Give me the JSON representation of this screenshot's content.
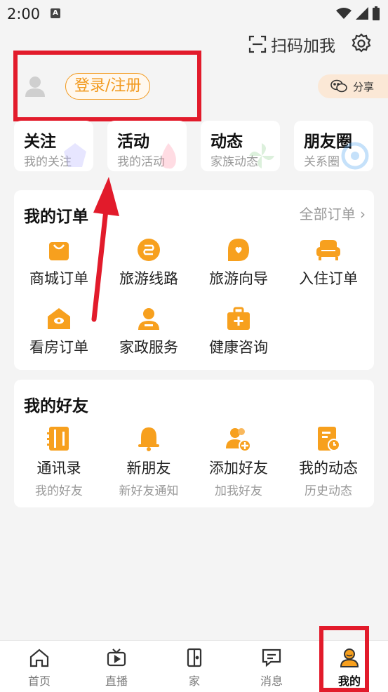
{
  "status_bar": {
    "time": "2:00",
    "notif_letter": "A"
  },
  "header": {
    "scan_label": "扫码加我",
    "login_label": "登录/注册",
    "share_label": "分享"
  },
  "quick_links": [
    {
      "title": "关注",
      "sub": "我的关注"
    },
    {
      "title": "活动",
      "sub": "我的活动"
    },
    {
      "title": "动态",
      "sub": "家族动态"
    },
    {
      "title": "朋友圈",
      "sub": "关系圈"
    }
  ],
  "orders": {
    "title": "我的订单",
    "all_label": "全部订单",
    "items": [
      {
        "label": "商城订单",
        "icon": "shopping-bag-icon"
      },
      {
        "label": "旅游线路",
        "icon": "route-icon"
      },
      {
        "label": "旅游向导",
        "icon": "guide-icon"
      },
      {
        "label": "入住订单",
        "icon": "sofa-icon"
      },
      {
        "label": "看房订单",
        "icon": "house-view-icon"
      },
      {
        "label": "家政服务",
        "icon": "housekeeper-icon"
      },
      {
        "label": "健康咨询",
        "icon": "medical-kit-icon"
      }
    ]
  },
  "friends": {
    "title": "我的好友",
    "items": [
      {
        "label": "通讯录",
        "sub": "我的好友",
        "icon": "contacts-icon"
      },
      {
        "label": "新朋友",
        "sub": "新好友通知",
        "icon": "bell-icon"
      },
      {
        "label": "添加好友",
        "sub": "加我好友",
        "icon": "add-friend-icon"
      },
      {
        "label": "我的动态",
        "sub": "历史动态",
        "icon": "history-icon"
      }
    ]
  },
  "tabs": [
    {
      "label": "首页",
      "icon": "home-icon"
    },
    {
      "label": "直播",
      "icon": "tv-icon"
    },
    {
      "label": "家",
      "icon": "door-icon"
    },
    {
      "label": "消息",
      "icon": "message-icon"
    },
    {
      "label": "我的",
      "icon": "profile-icon",
      "active": true
    }
  ],
  "colors": {
    "accent": "#F7A01E",
    "annotation": "#E21B2B"
  }
}
